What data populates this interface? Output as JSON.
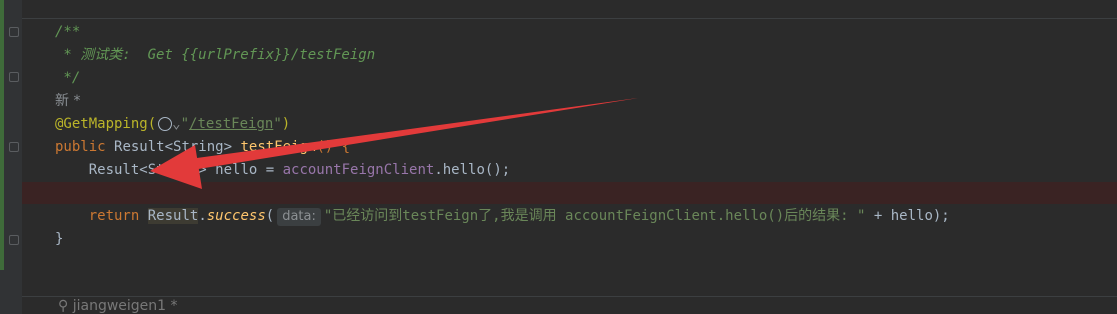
{
  "code": {
    "doc_open": "/**",
    "doc_comment": " * 测试类:  Get {{urlPrefix}}/testFeign",
    "doc_close": " */",
    "new_marker": "新 *",
    "ann_name": "@GetMapping(",
    "ann_quote_open": "\"",
    "ann_path": "/testFeign",
    "ann_quote_close": "\"",
    "ann_close": ")",
    "method_kw": "public",
    "method_type": "Result<String>",
    "method_name": "testFeign",
    "method_paren": "() {",
    "line_result_type": "Result<String>",
    "line_result_var": " hello = ",
    "line_client": "accountFeignClient",
    "line_call": ".hello();",
    "return_kw": "return",
    "success_obj": "Result",
    "success_dot": ".",
    "success_method": "success",
    "success_paren": "(",
    "param_hint": "data:",
    "string_literal": "\"已经访问到testFeign了,我是调用 accountFeignClient.hello()后的结果: \"",
    "concat": " + hello);",
    "closing_brace": "}"
  },
  "footer": {
    "author": "jiangweigen1 *"
  },
  "icons": {
    "globe": "globe-icon",
    "chevron": "chevron-down-icon",
    "arrow": "red-arrow-annotation"
  },
  "colors": {
    "arrow": "#e23a3a",
    "background": "#2b2b2b"
  }
}
